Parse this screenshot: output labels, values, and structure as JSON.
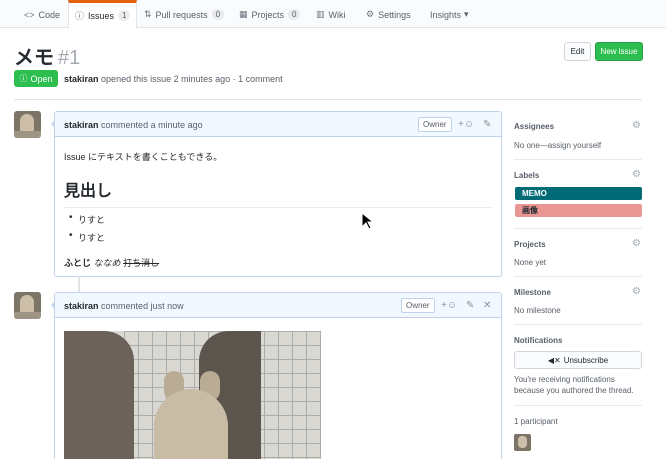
{
  "nav": {
    "tabs": [
      {
        "icon": "code-icon",
        "glyph": "<>",
        "label": "Code"
      },
      {
        "icon": "issue-opened-icon",
        "glyph": "ⓘ",
        "label": "Issues",
        "count": "1"
      },
      {
        "icon": "git-pull-request-icon",
        "glyph": "⇅",
        "label": "Pull requests",
        "count": "0"
      },
      {
        "icon": "project-icon",
        "glyph": "▦",
        "label": "Projects",
        "count": "0"
      },
      {
        "icon": "book-icon",
        "glyph": "▥",
        "label": "Wiki"
      },
      {
        "icon": "gear-icon",
        "glyph": "⚙",
        "label": "Settings"
      },
      {
        "label": "Insights",
        "glyph": "▾"
      }
    ]
  },
  "header": {
    "title": "メモ",
    "number": "#1",
    "edit_label": "Edit",
    "new_issue_label": "New issue",
    "state": "Open",
    "author": "stakiran",
    "meta_text": "opened this issue 2 minutes ago · 1 comment"
  },
  "comments": [
    {
      "author": "stakiran",
      "time": "commented a minute ago",
      "badge": "Owner",
      "body": {
        "paragraph": "Issue にテキストを書くこともできる。",
        "heading": "見出し",
        "list": [
          "りすと",
          "りすと"
        ],
        "bold": "ふとじ",
        "italic": "ななめ",
        "strike": "打ち消し"
      }
    },
    {
      "author": "stakiran",
      "time": "commented just now",
      "badge": "Owner"
    }
  ],
  "sidebar": {
    "assignees": {
      "heading": "Assignees",
      "value": "No one—assign yourself"
    },
    "labels": {
      "heading": "Labels",
      "items": [
        {
          "name": "MEMO",
          "color": "#006b75",
          "text_color": "#ffffff"
        },
        {
          "name": "画像",
          "color": "#e99695",
          "text_color": "#24292e"
        }
      ]
    },
    "projects": {
      "heading": "Projects",
      "value": "None yet"
    },
    "milestone": {
      "heading": "Milestone",
      "value": "No milestone"
    },
    "notifications": {
      "heading": "Notifications",
      "button": "Unsubscribe",
      "notice": "You're receiving notifications because you authored the thread."
    },
    "participants": {
      "heading": "1 participant"
    }
  },
  "colors": {
    "accent": "#e36209",
    "open_green": "#2cbe4e",
    "comment_header": "#f1f8ff"
  }
}
